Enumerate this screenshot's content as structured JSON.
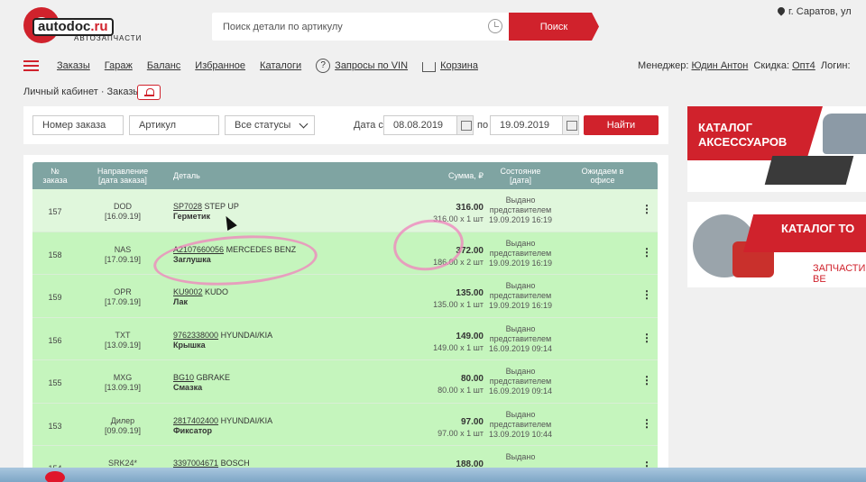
{
  "header": {
    "brand_name": "autodoc",
    "brand_tld": ".ru",
    "brand_subtitle": "АВТОЗАПЧАСТИ",
    "search_placeholder": "Поиск детали по артикулу",
    "search_button": "Поиск",
    "city": "г. Саратов, ул"
  },
  "nav": {
    "items": [
      "Заказы",
      "Гараж",
      "Баланс",
      "Избранное",
      "Каталоги"
    ],
    "vin_label": "Запросы по VIN",
    "cart_label": "Корзина",
    "manager_label": "Менеджер:",
    "manager_name": "Юдин Антон",
    "discount_label": "Скидка:",
    "discount_value": "Опт4",
    "login_label": "Логин:"
  },
  "breadcrumb": "Личный кабинет · Заказы",
  "filters": {
    "order_placeholder": "Номер заказа",
    "article_placeholder": "Артикул",
    "status_value": "Все статусы",
    "date_from_label": "Дата с",
    "date_from": "08.08.2019",
    "date_to_label": "по",
    "date_to": "19.09.2019",
    "find_button": "Найти"
  },
  "table": {
    "headers": {
      "num": [
        "№",
        "заказа"
      ],
      "direction": [
        "Направление",
        "[дата заказа]"
      ],
      "part": "Деталь",
      "sum": "Сумма, ₽",
      "state": [
        "Состояние",
        "[дата]"
      ],
      "awaiting": [
        "Ожидаем в",
        "офисе"
      ]
    },
    "rows": [
      {
        "num": "157",
        "dir": "DOD",
        "date": "[16.09.19]",
        "article": "SP7028",
        "brand": "STEP UP",
        "name": "Герметик",
        "total": "316.00",
        "qty": "316.00 x 1 шт",
        "state": [
          "Выдано",
          "представителем"
        ],
        "state_date": "19.09.2019 16:19"
      },
      {
        "num": "158",
        "dir": "NAS",
        "date": "[17.09.19]",
        "article": "A2107660056",
        "brand": "MERCEDES BENZ",
        "name": "Заглушка",
        "total": "372.00",
        "qty": "186.00 x 2 шт",
        "state": [
          "Выдано",
          "представителем"
        ],
        "state_date": "19.09.2019 16:19"
      },
      {
        "num": "159",
        "dir": "OPR",
        "date": "[17.09.19]",
        "article": "KU9002",
        "brand": "KUDO",
        "name": "Лак",
        "total": "135.00",
        "qty": "135.00 x 1 шт",
        "state": [
          "Выдано",
          "представителем"
        ],
        "state_date": "19.09.2019 16:19"
      },
      {
        "num": "156",
        "dir": "TXT",
        "date": "[13.09.19]",
        "article": "9762338000",
        "brand": "HYUNDAI/KIA",
        "name": "Крышка",
        "total": "149.00",
        "qty": "149.00 x 1 шт",
        "state": [
          "Выдано",
          "представителем"
        ],
        "state_date": "16.09.2019 09:14"
      },
      {
        "num": "155",
        "dir": "MXG",
        "date": "[13.09.19]",
        "article": "BG10",
        "brand": "GBRAKE",
        "name": "Смазка",
        "total": "80.00",
        "qty": "80.00 x 1 шт",
        "state": [
          "Выдано",
          "представителем"
        ],
        "state_date": "16.09.2019 09:14"
      },
      {
        "num": "153",
        "dir": "Дилер",
        "date": "[09.09.19]",
        "article": "2817402400",
        "brand": "HYUNDAI/KIA",
        "name": "Фиксатор",
        "total": "97.00",
        "qty": "97.00 x 1 шт",
        "state": [
          "Выдано",
          "представителем"
        ],
        "state_date": "13.09.2019 10:44"
      },
      {
        "num": "154",
        "dir": "SRK24*",
        "date": "",
        "article": "3397004671",
        "brand": "BOSCH",
        "name": "",
        "total": "188.00",
        "qty": "",
        "state": [
          "Выдано",
          ""
        ],
        "state_date": ""
      }
    ]
  },
  "banners": {
    "accessories": [
      "КАТАЛОГ",
      "АКСЕССУАРОВ"
    ],
    "to_catalog": "КАТАЛОГ ТО",
    "to_sub": "ЗАПЧАСТИ ВЕ"
  },
  "colors": {
    "accent": "#d0222c",
    "table_header": "#7fa4a2",
    "row_green": "#c5f5bd"
  }
}
